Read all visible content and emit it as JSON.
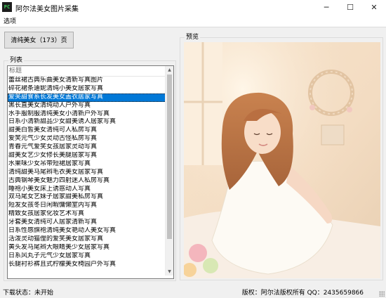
{
  "window": {
    "title": "阿尔法美女图片采集",
    "icon_label": "PC",
    "controls": {
      "minimize": "─",
      "maximize": "☐",
      "close": "✕"
    }
  },
  "menu": {
    "options_label": "选项"
  },
  "toolbar": {
    "clean_page_label": "清纯美女（173）页"
  },
  "list_group": {
    "label": "列表",
    "column_header": "标题",
    "selected_index": 2,
    "items": [
      "蕾丝裙古典乐曲美女清新写真图片",
      "碎花裙条迪妮清纯小美女居家写真",
      "爱笑甜食系长发美女盖衣居家写真",
      "黑长直美女清纯动人户外写真",
      "水手服制服清纯美女小清新户外写真",
      "日系小清新甜品少女甜美诱人居家写真",
      "甜美白皙美女清纯可人私房写真",
      "爱笑元气少女灵动古怪私房写真",
      "青春元气爱笑女孩居家灵动写真",
      "甜美女艺少女修长美腿居家写真",
      "水果味少女吊带短裙居家写真",
      "清纯甜美马尾辫毛衣美女居家写真",
      "古典钢琴美女魅力四射迷人私房写真",
      "睡袍小美女床上诱惑动人写真",
      "双马尾女艺妹子居家甜美私房写真",
      "短发女孩冬日闲暇慵懒室内写真",
      "精致女孩居家化妆艺术写真",
      "牙套美女清纯可人居家清新写真",
      "日系性感旗袍清纯美女艳动人美女写真",
      "活泼灵动猫俚的爱笑美女居家写真",
      "黄头发马尾辫大眼睛美少女居家写真",
      "日系风丸子元气少女居家写真",
      "长腿衬衫裤且式柠檬美女椅园户外写真"
    ]
  },
  "preview_group": {
    "label": "预览"
  },
  "status": {
    "download_status": "下载状态：未开始",
    "copyright": "版权：阿尔法版权所有 QQ：2435659866"
  },
  "colors": {
    "selection": "#0078d7",
    "background": "#f0f0f0"
  }
}
